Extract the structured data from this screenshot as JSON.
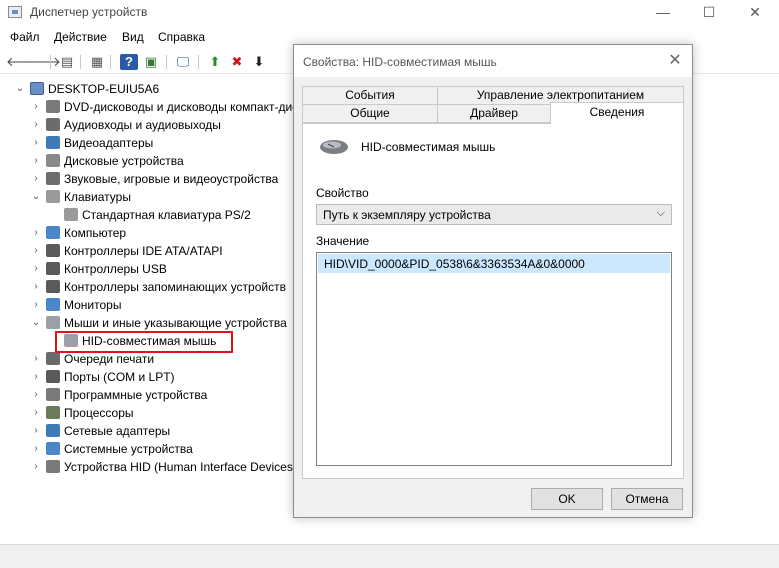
{
  "window": {
    "title": "Диспетчер устройств",
    "minimize": "—",
    "maximize": "☐",
    "close": "✕"
  },
  "menu": [
    "Файл",
    "Действие",
    "Вид",
    "Справка"
  ],
  "toolbar": {
    "back": "🡐",
    "forward": "🡒",
    "properties": "▤",
    "view": "▦",
    "help": "?",
    "scan": "▣",
    "monitor": "🖵",
    "update_driver": "⬆",
    "disable": "✖",
    "uninstall": "⬇"
  },
  "tree": {
    "root": "DESKTOP-EUIU5A6",
    "items": [
      {
        "label": "DVD-дисководы и дисководы компакт-дисков",
        "expander": "›",
        "icon": "dvd-drive-icon"
      },
      {
        "label": "Аудиовходы и аудиовыходы",
        "expander": "›",
        "icon": "audio-icon"
      },
      {
        "label": "Видеоадаптеры",
        "expander": "›",
        "icon": "display-adapter-icon"
      },
      {
        "label": "Дисковые устройства",
        "expander": "›",
        "icon": "disk-drive-icon"
      },
      {
        "label": "Звуковые, игровые и видеоустройства",
        "expander": "›",
        "icon": "speaker-icon"
      },
      {
        "label": "Клавиатуры",
        "expander": "⌄",
        "icon": "keyboard-icon"
      },
      {
        "label": "Стандартная клавиатура PS/2",
        "expander": "",
        "icon": "keyboard-icon",
        "child": true
      },
      {
        "label": "Компьютер",
        "expander": "›",
        "icon": "computer-icon"
      },
      {
        "label": "Контроллеры IDE ATA/ATAPI",
        "expander": "›",
        "icon": "ide-controller-icon"
      },
      {
        "label": "Контроллеры USB",
        "expander": "›",
        "icon": "usb-icon"
      },
      {
        "label": "Контроллеры запоминающих устройств",
        "expander": "›",
        "icon": "storage-controller-icon"
      },
      {
        "label": "Мониторы",
        "expander": "›",
        "icon": "monitor-icon"
      },
      {
        "label": "Мыши и иные указывающие устройства",
        "expander": "⌄",
        "icon": "mouse-icon"
      },
      {
        "label": "HID-совместимая мышь",
        "expander": "",
        "icon": "mouse-icon",
        "child": true
      },
      {
        "label": "Очереди печати",
        "expander": "›",
        "icon": "printer-icon"
      },
      {
        "label": "Порты (COM и LPT)",
        "expander": "›",
        "icon": "port-icon"
      },
      {
        "label": "Программные устройства",
        "expander": "›",
        "icon": "software-device-icon"
      },
      {
        "label": "Процессоры",
        "expander": "›",
        "icon": "processor-icon"
      },
      {
        "label": "Сетевые адаптеры",
        "expander": "›",
        "icon": "network-adapter-icon"
      },
      {
        "label": "Системные устройства",
        "expander": "›",
        "icon": "system-device-icon"
      },
      {
        "label": "Устройства HID (Human Interface Devices)",
        "expander": "›",
        "icon": "hid-icon"
      }
    ]
  },
  "dialog": {
    "title": "Свойства: HID-совместимая мышь",
    "close": "✕",
    "tabs_row1": [
      "События",
      "Управление электропитанием"
    ],
    "tabs_row2": [
      "Общие",
      "Драйвер",
      "Сведения"
    ],
    "device_name": "HID-совместимая мышь",
    "property_label": "Свойство",
    "property_value": "Путь к экземпляру устройства",
    "value_label": "Значение",
    "value_items": [
      "HID\\VID_0000&PID_0538\\6&3363534A&0&0000"
    ],
    "ok": "OK",
    "cancel": "Отмена"
  },
  "colors": {
    "highlight_border": "#e0141e",
    "selection": "#cce8ff"
  }
}
